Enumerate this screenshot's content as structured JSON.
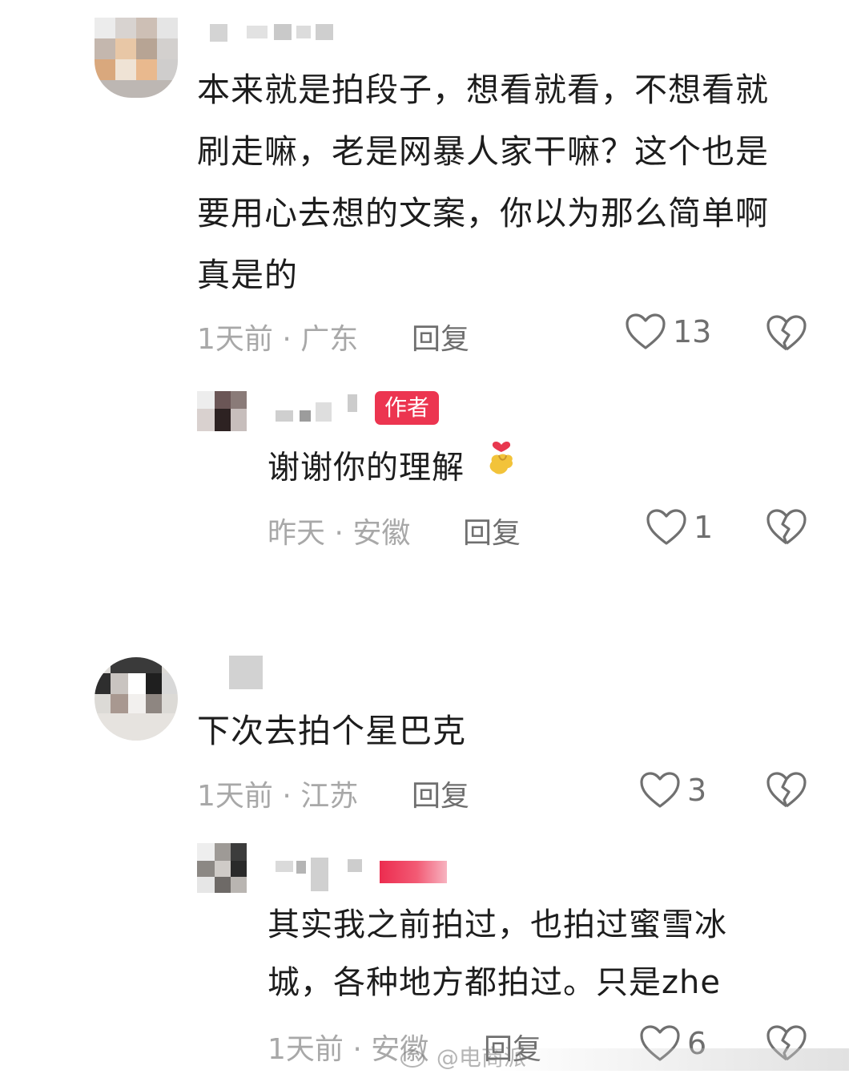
{
  "comments": [
    {
      "text": "本来就是拍段子，想看就看，不想看就刷走嘛，老是网暴人家干嘛？这个也是要用心去想的文案，你以为那么简单啊真是的",
      "meta": "1天前 · 广东",
      "reply_label": "回复",
      "likes": "13",
      "reply": {
        "badge": "作者",
        "text": "谢谢你的理解",
        "meta": "昨天 · 安徽",
        "reply_label": "回复",
        "likes": "1"
      }
    },
    {
      "text": "下次去拍个星巴克",
      "meta": "1天前 · 江苏",
      "reply_label": "回复",
      "likes": "3",
      "reply": {
        "text": "其实我之前拍过，也拍过蜜雪冰城，各种地方都拍过。只是zhe",
        "meta": "1天前 · 安徽",
        "reply_label": "回复",
        "likes": "6"
      }
    }
  ],
  "watermark": "@电商派",
  "colors": {
    "author_badge": "#ec3550",
    "meta_gray": "#a8a8a8",
    "action_gray": "#6f6f6f"
  },
  "icons": [
    "heart-outline-icon",
    "broken-heart-icon",
    "heart-hands-emoji"
  ]
}
